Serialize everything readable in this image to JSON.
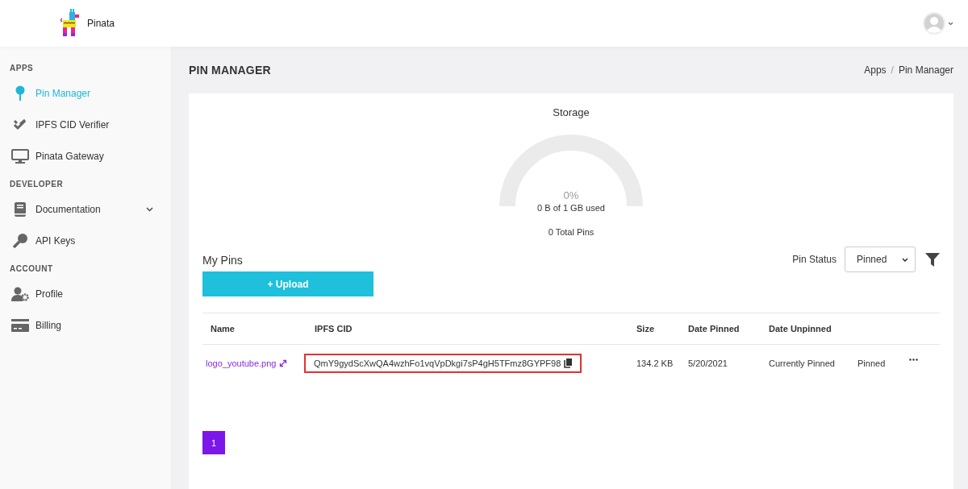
{
  "header": {
    "brand": "Pinata"
  },
  "sidebar": {
    "sections": [
      {
        "heading": "APPS",
        "items": [
          {
            "label": "Pin Manager",
            "selected": true,
            "kind": "link"
          },
          {
            "label": "IPFS CID Verifier",
            "selected": false,
            "kind": "link"
          },
          {
            "label": "Pinata Gateway",
            "selected": false,
            "kind": "link"
          }
        ]
      },
      {
        "heading": "DEVELOPER",
        "items": [
          {
            "label": "Documentation",
            "selected": false,
            "kind": "dropdown",
            "expanded": false
          },
          {
            "label": "API Keys",
            "selected": false,
            "kind": "link"
          }
        ]
      },
      {
        "heading": "ACCOUNT",
        "items": [
          {
            "label": "Profile",
            "selected": false,
            "kind": "link"
          },
          {
            "label": "Billing",
            "selected": false,
            "kind": "link"
          }
        ]
      }
    ]
  },
  "page": {
    "title": "PIN MANAGER",
    "breadcrumb": [
      "Apps",
      "Pin Manager"
    ],
    "breadcrumb_separator": "/"
  },
  "storage": {
    "title": "Storage",
    "percent": "0%",
    "usage": "0 B of 1 GB used",
    "total_pins": "0 Total Pins"
  },
  "pins": {
    "title": "My Pins",
    "upload_button": "+ Upload",
    "filter_label": "Pin Status",
    "filter_value": "Pinned"
  },
  "table": {
    "columns": [
      "Name",
      "IPFS CID",
      "Size",
      "Date Pinned",
      "Date Unpinned"
    ],
    "rows": [
      {
        "name": "logo_youtube.png",
        "cid": "QmY9gydScXwQA4wzhFo1vqVpDkgi7sP4gH5TFmz8GYPF98",
        "highlighted": true,
        "size": "134.2 KB",
        "date_pinned": "5/20/2021",
        "date_unpinned": "Currently Pinned",
        "status": "Pinned"
      }
    ]
  },
  "pagination": [
    {
      "label": "1",
      "selected": true
    }
  ]
}
